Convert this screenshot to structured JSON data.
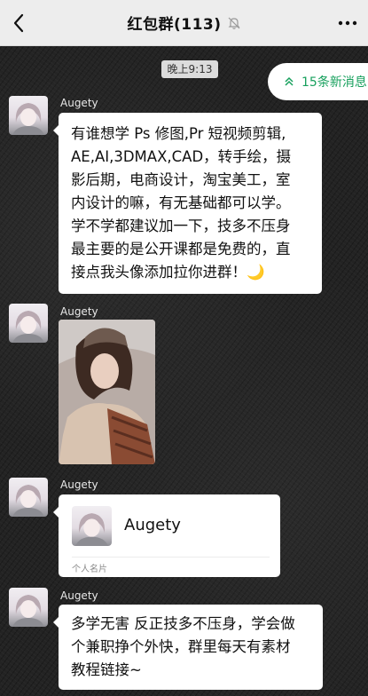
{
  "header": {
    "title": "红包群(113)",
    "back_icon": "chevron-left-icon",
    "mute_icon": "bell-muted-icon",
    "more_icon": "more-icon"
  },
  "timestamp": "晚上9:13",
  "new_messages": {
    "label": "15条新消息",
    "icon": "double-chevron-up-icon",
    "color": "#17a05d"
  },
  "messages": [
    {
      "sender": "Augety",
      "type": "text",
      "lines": [
        "有谁想学 Ps 修图,Pr 短视频剪辑,",
        "AE,AI,3DMAX,CAD，转手绘，摄",
        "影后期，电商设计，淘宝美工，室",
        "内设计的嘛，有无基础都可以学。",
        "学不学都建议加一下，技多不压身",
        "最主要的是公开课都是免费的，直",
        "接点我头像添加拉你进群！🌙"
      ]
    },
    {
      "sender": "Augety",
      "type": "image"
    },
    {
      "sender": "Augety",
      "type": "contact_card",
      "card_name": "Augety",
      "card_type": "个人名片"
    },
    {
      "sender": "Augety",
      "type": "text",
      "lines": [
        "多学无害 反正技多不压身，学会做",
        "个兼职挣个外快，群里每天有素材",
        "教程链接~"
      ]
    }
  ]
}
